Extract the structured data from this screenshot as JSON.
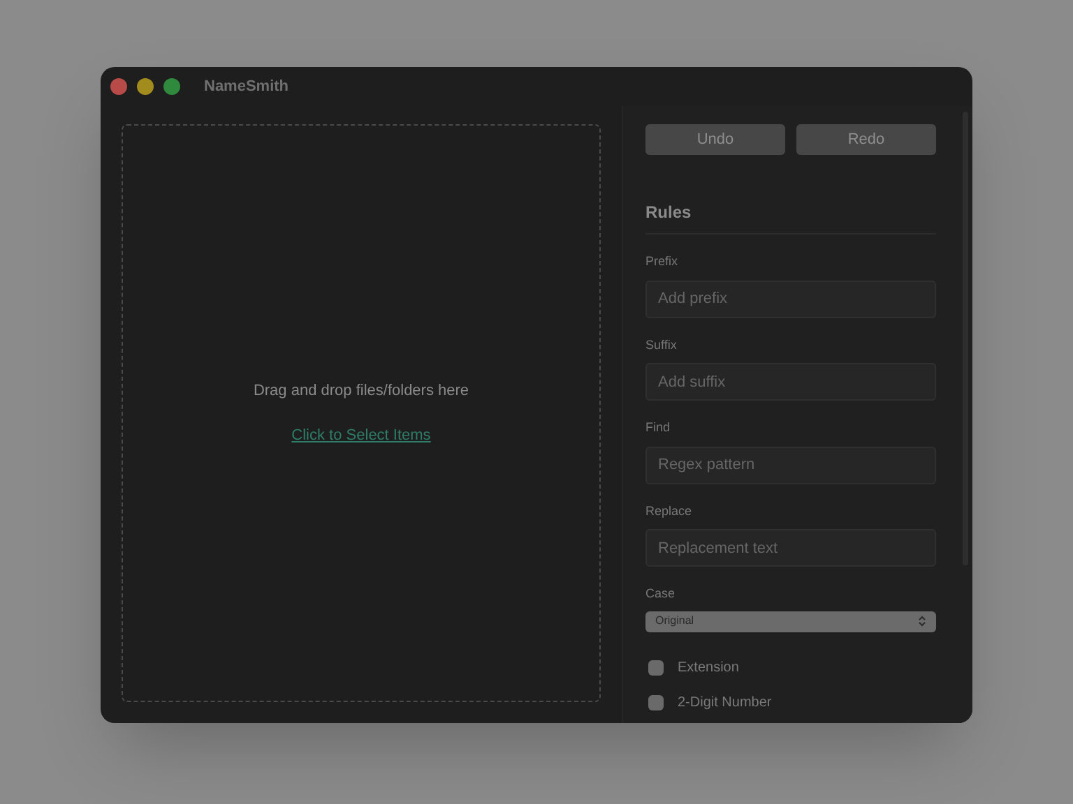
{
  "window": {
    "title": "NameSmith"
  },
  "drop_zone": {
    "text": "Drag and drop files/folders here",
    "link": "Click to Select Items"
  },
  "toolbar": [
    {
      "label": "Undo",
      "disabled": true
    },
    {
      "label": "Redo",
      "disabled": true
    }
  ],
  "rules": {
    "title": "Rules",
    "fields": [
      {
        "label": "Prefix",
        "placeholder": "Add prefix"
      },
      {
        "label": "Suffix",
        "placeholder": "Add suffix"
      },
      {
        "label": "Find",
        "placeholder": "Regex pattern"
      },
      {
        "label": "Replace",
        "placeholder": "Replacement text"
      }
    ],
    "case": {
      "label": "Case",
      "value": "Original"
    },
    "options": [
      {
        "label": "Extension",
        "checked": false
      },
      {
        "label": "2-Digit Number",
        "checked": false
      }
    ]
  }
}
